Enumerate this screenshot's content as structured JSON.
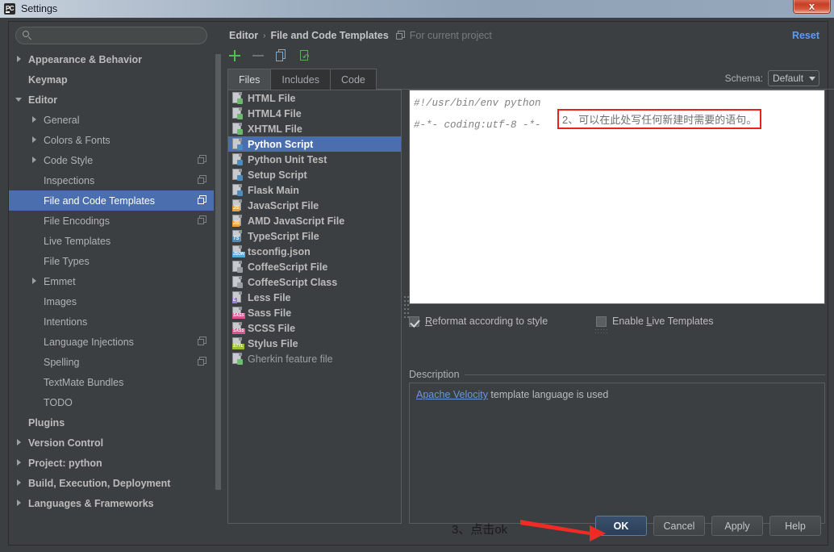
{
  "window": {
    "title": "Settings",
    "app_icon": "pycharm-icon",
    "close_label": "x"
  },
  "search": {
    "value": "",
    "placeholder": ""
  },
  "sidebar": {
    "items": [
      {
        "label": "Appearance & Behavior",
        "level": 0,
        "arrow": "closed",
        "selected": false,
        "badge": false
      },
      {
        "label": "Keymap",
        "level": 0,
        "arrow": "none",
        "selected": false,
        "badge": false
      },
      {
        "label": "Editor",
        "level": 0,
        "arrow": "open",
        "selected": false,
        "badge": false
      },
      {
        "label": "General",
        "level": 1,
        "arrow": "closed",
        "selected": false,
        "badge": false
      },
      {
        "label": "Colors & Fonts",
        "level": 1,
        "arrow": "closed",
        "selected": false,
        "badge": false
      },
      {
        "label": "Code Style",
        "level": 1,
        "arrow": "closed",
        "selected": false,
        "badge": true
      },
      {
        "label": "Inspections",
        "level": 1,
        "arrow": "none",
        "selected": false,
        "badge": true
      },
      {
        "label": "File and Code Templates",
        "level": 1,
        "arrow": "none",
        "selected": true,
        "badge": true
      },
      {
        "label": "File Encodings",
        "level": 1,
        "arrow": "none",
        "selected": false,
        "badge": true
      },
      {
        "label": "Live Templates",
        "level": 1,
        "arrow": "none",
        "selected": false,
        "badge": false
      },
      {
        "label": "File Types",
        "level": 1,
        "arrow": "none",
        "selected": false,
        "badge": false
      },
      {
        "label": "Emmet",
        "level": 1,
        "arrow": "closed",
        "selected": false,
        "badge": false
      },
      {
        "label": "Images",
        "level": 1,
        "arrow": "none",
        "selected": false,
        "badge": false
      },
      {
        "label": "Intentions",
        "level": 1,
        "arrow": "none",
        "selected": false,
        "badge": false
      },
      {
        "label": "Language Injections",
        "level": 1,
        "arrow": "none",
        "selected": false,
        "badge": true
      },
      {
        "label": "Spelling",
        "level": 1,
        "arrow": "none",
        "selected": false,
        "badge": true
      },
      {
        "label": "TextMate Bundles",
        "level": 1,
        "arrow": "none",
        "selected": false,
        "badge": false
      },
      {
        "label": "TODO",
        "level": 1,
        "arrow": "none",
        "selected": false,
        "badge": false
      },
      {
        "label": "Plugins",
        "level": 0,
        "arrow": "none",
        "selected": false,
        "badge": false
      },
      {
        "label": "Version Control",
        "level": 0,
        "arrow": "closed",
        "selected": false,
        "badge": false
      },
      {
        "label": "Project: python",
        "level": 0,
        "arrow": "closed",
        "selected": false,
        "badge": false
      },
      {
        "label": "Build, Execution, Deployment",
        "level": 0,
        "arrow": "closed",
        "selected": false,
        "badge": false
      },
      {
        "label": "Languages & Frameworks",
        "level": 0,
        "arrow": "closed",
        "selected": false,
        "badge": false
      }
    ]
  },
  "header": {
    "breadcrumb_root": "Editor",
    "breadcrumb_sep": "›",
    "breadcrumb_leaf": "File and Code Templates",
    "scope_text": "For current project",
    "reset_label": "Reset",
    "schema_label": "Schema:",
    "schema_value": "Default"
  },
  "toolbar": {
    "add_icon": "plus-icon",
    "remove_icon": "minus-icon",
    "copy_icon": "copy-icon",
    "reset_icon": "reset-template-icon"
  },
  "tabs": [
    {
      "label": "Files",
      "active": true
    },
    {
      "label": "Includes",
      "active": false
    },
    {
      "label": "Code",
      "active": false
    }
  ],
  "templates": [
    {
      "label": "HTML File",
      "icon": "html-file-icon",
      "tag": "",
      "color": "#6cb86c",
      "selected": false,
      "muted": false
    },
    {
      "label": "HTML4 File",
      "icon": "html-file-icon",
      "tag": "",
      "color": "#6cb86c",
      "selected": false,
      "muted": false
    },
    {
      "label": "XHTML File",
      "icon": "xhtml-file-icon",
      "tag": "",
      "color": "#6cb86c",
      "selected": false,
      "muted": false
    },
    {
      "label": "Python Script",
      "icon": "python-file-icon",
      "tag": "",
      "color": "#4b8bbe",
      "selected": true,
      "muted": false
    },
    {
      "label": "Python Unit Test",
      "icon": "python-file-icon",
      "tag": "",
      "color": "#4b8bbe",
      "selected": false,
      "muted": false
    },
    {
      "label": "Setup Script",
      "icon": "python-file-icon",
      "tag": "",
      "color": "#4b8bbe",
      "selected": false,
      "muted": false
    },
    {
      "label": "Flask Main",
      "icon": "python-file-icon",
      "tag": "",
      "color": "#4b8bbe",
      "selected": false,
      "muted": false
    },
    {
      "label": "JavaScript File",
      "icon": "javascript-file-icon",
      "tag": "JS",
      "color": "#e8a33d",
      "selected": false,
      "muted": false
    },
    {
      "label": "AMD JavaScript File",
      "icon": "javascript-file-icon",
      "tag": "JS",
      "color": "#e8a33d",
      "selected": false,
      "muted": false
    },
    {
      "label": "TypeScript File",
      "icon": "typescript-file-icon",
      "tag": "TS",
      "color": "#4b8bbe",
      "selected": false,
      "muted": false
    },
    {
      "label": "tsconfig.json",
      "icon": "json-file-icon",
      "tag": "JSON",
      "color": "#5aa9d6",
      "selected": false,
      "muted": false
    },
    {
      "label": "CoffeeScript File",
      "icon": "coffeescript-file-icon",
      "tag": "",
      "color": "#9a9fa2",
      "selected": false,
      "muted": false
    },
    {
      "label": "CoffeeScript Class",
      "icon": "coffeescript-file-icon",
      "tag": "",
      "color": "#9a9fa2",
      "selected": false,
      "muted": false
    },
    {
      "label": "Less File",
      "icon": "less-file-icon",
      "tag": "L",
      "color": "#9a7fd8",
      "selected": false,
      "muted": false
    },
    {
      "label": "Sass File",
      "icon": "sass-file-icon",
      "tag": "SASS",
      "color": "#e0508f",
      "selected": false,
      "muted": false
    },
    {
      "label": "SCSS File",
      "icon": "scss-file-icon",
      "tag": "SASS",
      "color": "#e0508f",
      "selected": false,
      "muted": false
    },
    {
      "label": "Stylus File",
      "icon": "stylus-file-icon",
      "tag": "STYL",
      "color": "#9bbf33",
      "selected": false,
      "muted": false
    },
    {
      "label": "Gherkin feature file",
      "icon": "gherkin-file-icon",
      "tag": "",
      "color": "#6cc06c",
      "selected": false,
      "muted": true
    }
  ],
  "editor": {
    "line1": "#!/usr/bin/env python",
    "line2": "#-*- coding:utf-8 -*-",
    "annotation": "2、可以在此处写任何新建时需要的语句。",
    "annotation_color": "#e8231c"
  },
  "options": {
    "reformat": {
      "label": "Reformat according to style",
      "checked": true
    },
    "live_templates": {
      "label": "Enable Live Templates",
      "checked": false
    }
  },
  "description": {
    "legend": "Description",
    "link_text": "Apache Velocity",
    "rest_text": " template language is used"
  },
  "buttons": {
    "ok": "OK",
    "cancel": "Cancel",
    "apply": "Apply",
    "help": "Help"
  },
  "annotations": {
    "step3": "3、点击ok",
    "arrow_color": "#ee2c24"
  }
}
